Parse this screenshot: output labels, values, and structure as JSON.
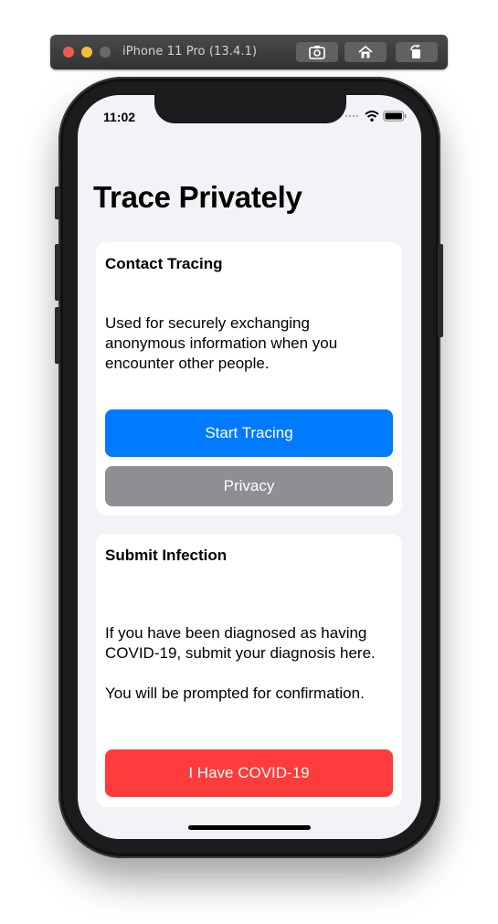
{
  "simulator": {
    "title": "iPhone 11 Pro (13.4.1)",
    "buttons": [
      {
        "icon": "screenshot-icon"
      },
      {
        "icon": "home-icon"
      },
      {
        "icon": "rotate-icon"
      }
    ]
  },
  "status_bar": {
    "time": "11:02",
    "icons": [
      "signal-icon",
      "wifi-icon",
      "battery-icon"
    ]
  },
  "page": {
    "title": "Trace Privately"
  },
  "contact_tracing": {
    "title": "Contact Tracing",
    "description": "Used for securely exchanging anonymous information when you encounter other people.",
    "start_button": "Start Tracing",
    "privacy_button": "Privacy"
  },
  "submit_infection": {
    "title": "Submit Infection",
    "description": "If you have been diagnosed as having COVID-19, submit your diagnosis here.",
    "note": "You will be prompted for confirmation.",
    "covid_button": "I Have COVID-19"
  },
  "colors": {
    "accent_blue": "#007aff",
    "privacy_gray": "#8e8e93",
    "danger_red": "#ff3b3b",
    "background": "#f2f2f7"
  }
}
